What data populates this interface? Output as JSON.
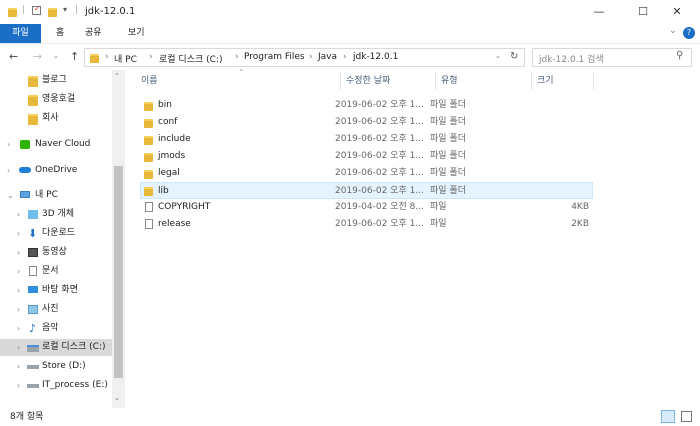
{
  "window": {
    "title": "jdk-12.0.1",
    "min": "—",
    "max": "☐",
    "close": "✕"
  },
  "ribbon": {
    "tabs": [
      "파일",
      "홈",
      "공유",
      "보기"
    ],
    "expand": "⌄",
    "help": "?"
  },
  "address": {
    "path": [
      "내 PC",
      "로컬 디스크 (C:)",
      "Program Files",
      "Java",
      "jdk-12.0.1"
    ],
    "search_placeholder": "jdk-12.0.1 검색"
  },
  "nav": {
    "items": [
      {
        "label": "블로그"
      },
      {
        "label": "영웅호걸"
      },
      {
        "label": "회사"
      },
      {
        "label": "Naver Cloud"
      },
      {
        "label": "OneDrive"
      },
      {
        "label": "내 PC"
      },
      {
        "label": "3D 개체"
      },
      {
        "label": "다운로드"
      },
      {
        "label": "동영상"
      },
      {
        "label": "문서"
      },
      {
        "label": "바탕 화면"
      },
      {
        "label": "사진"
      },
      {
        "label": "음악"
      },
      {
        "label": "로컬 디스크 (C:)"
      },
      {
        "label": "Store (D:)"
      },
      {
        "label": "IT_process (E:)"
      }
    ]
  },
  "columns": {
    "name": "이름",
    "date": "수정한 날짜",
    "type": "유형",
    "size": "크기"
  },
  "files": [
    {
      "name": "bin",
      "date": "2019-06-02 오후 1...",
      "type": "파일 폴더",
      "size": ""
    },
    {
      "name": "conf",
      "date": "2019-06-02 오후 1...",
      "type": "파일 폴더",
      "size": ""
    },
    {
      "name": "include",
      "date": "2019-06-02 오후 1...",
      "type": "파일 폴더",
      "size": ""
    },
    {
      "name": "jmods",
      "date": "2019-06-02 오후 1...",
      "type": "파일 폴더",
      "size": ""
    },
    {
      "name": "legal",
      "date": "2019-06-02 오후 1...",
      "type": "파일 폴더",
      "size": ""
    },
    {
      "name": "lib",
      "date": "2019-06-02 오후 1...",
      "type": "파일 폴더",
      "size": ""
    },
    {
      "name": "COPYRIGHT",
      "date": "2019-04-02 오전 8...",
      "type": "파일",
      "size": "4KB"
    },
    {
      "name": "release",
      "date": "2019-06-02 오후 1...",
      "type": "파일",
      "size": "2KB"
    }
  ],
  "status": {
    "count": "8개 항목"
  }
}
